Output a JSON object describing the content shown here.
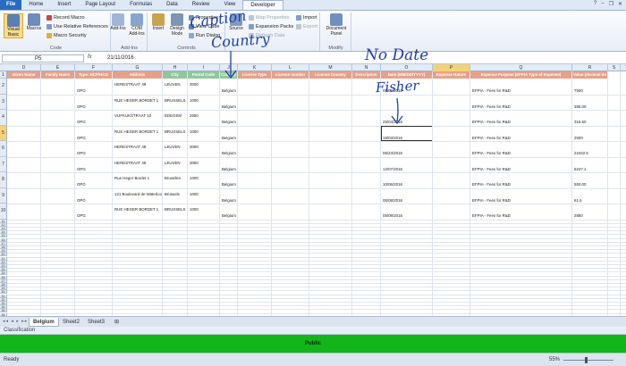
{
  "tabs": [
    "File",
    "Home",
    "Insert",
    "Page Layout",
    "Formulas",
    "Data",
    "Review",
    "View",
    "Developer"
  ],
  "active_tab": "Developer",
  "ribbon": {
    "code": {
      "name": "Code",
      "visual_basic": "Visual Basic",
      "macros": "Macros",
      "record_macro": "Record Macro",
      "relative_refs": "Use Relative References",
      "macro_security": "Macro Security"
    },
    "addins": {
      "name": "Add-Ins",
      "addins": "Add-Ins",
      "com_addins": "COM Add-Ins"
    },
    "controls": {
      "name": "Controls",
      "insert": "Insert",
      "design_mode": "Design Mode",
      "properties": "Properties",
      "view_code": "View Code",
      "run_dialog": "Run Dialog"
    },
    "xml": {
      "source": "Source",
      "map_properties": "Map Properties",
      "expansion_packs": "Expansion Packs",
      "refresh_data": "Refresh Data",
      "import": "Import",
      "export": "Export"
    },
    "modify": {
      "name": "Modify",
      "document_panel": "Document Panel"
    }
  },
  "formula_bar": {
    "name_box": "P5",
    "fx": "fx",
    "value": "21/11/2016"
  },
  "columns": [
    "D",
    "E",
    "F",
    "G",
    "H",
    "I",
    "J",
    "K",
    "L",
    "M",
    "N",
    "O",
    "P",
    "Q",
    "R",
    "S",
    "T"
  ],
  "selected_column": "P",
  "headers": [
    "Given Name",
    "Family Name",
    "Type: HCP/HCO",
    "Address",
    "City",
    "Postal Code",
    "Country",
    "License Type",
    "License number",
    "License Country",
    "Description",
    "Date (MM/DD/YYYY)",
    "Expense Nature",
    "Expense Purpose (EFPIA Type of Expense)",
    "Value (decimal do"
  ],
  "rows": [
    {
      "n": "2",
      "type": "OPG",
      "address": "HERESTRAAT 49",
      "city": "LEUVEN",
      "postal": "3000",
      "country": "Belgium",
      "date": "05/09/2016",
      "nature": "",
      "purpose": "EFPIA - Fees for R&D",
      "value": "7500"
    },
    {
      "n": "3",
      "type": "OPG",
      "address": "RUE HEGER BORDET 1",
      "city": "BRUSSELS",
      "postal": "1000",
      "country": "Belgium",
      "date": "",
      "nature": "",
      "purpose": "EFPIA - Fees for R&D",
      "value": "385.00"
    },
    {
      "n": "4",
      "type": "OPG",
      "address": "VIJFKUKSTRAAT 10",
      "city": "EDEGEM",
      "postal": "2650",
      "country": "Belgium",
      "date": "25/04/2016",
      "nature": "",
      "purpose": "EFPIA - Fees for R&D",
      "value": "316.50"
    },
    {
      "n": "5",
      "type": "OPG",
      "address": "RUE HEGER BORDET 1",
      "city": "BRUSSELS",
      "postal": "1000",
      "country": "Belgium",
      "date": "18/03/2016",
      "nature": "",
      "purpose": "EFPIA - Fees for R&D",
      "value": "2500"
    },
    {
      "n": "6",
      "type": "OPG",
      "address": "HERESTRAAT 49",
      "city": "LEUVEN",
      "postal": "3000",
      "country": "Belgium",
      "date": "06/23/2016",
      "nature": "",
      "purpose": "EFPIA - Fees for R&D",
      "value": "22422.5"
    },
    {
      "n": "7",
      "type": "OPG",
      "address": "HERESTRAAT 49",
      "city": "LEUVEN",
      "postal": "3000",
      "country": "Belgium",
      "date": "12/07/2016",
      "nature": "",
      "purpose": "EFPIA - Fees for R&D",
      "value": "6247.1"
    },
    {
      "n": "8",
      "type": "OPG",
      "address": "Rue Heger Bordet 1",
      "city": "Bruxelles",
      "postal": "1000",
      "country": "Belgium",
      "date": "10/06/2016",
      "nature": "",
      "purpose": "EFPIA - Fees for R&D",
      "value": "550.00"
    },
    {
      "n": "9",
      "type": "OPG",
      "address": "121 Boulevard de Waterloo",
      "city": "Brussels",
      "postal": "1000",
      "country": "Belgium",
      "date": "05/08/2016",
      "nature": "",
      "purpose": "EFPIA - Fees for R&D",
      "value": "61.6"
    },
    {
      "n": "10",
      "type": "OPG",
      "address": "RUE HEGER BORDET 1",
      "city": "BRUSSELS",
      "postal": "1000",
      "country": "Belgium",
      "date": "05/09/2016",
      "nature": "",
      "purpose": "EFPIA - Fees for R&D",
      "value": "2850"
    }
  ],
  "empty_rows": [
    "11",
    "12",
    "13",
    "14",
    "15",
    "16",
    "17",
    "18",
    "19",
    "20",
    "21",
    "22",
    "23",
    "24",
    "25",
    "26",
    "27",
    "28",
    "29",
    "30",
    "31",
    "32",
    "33",
    "34",
    "35",
    "36",
    "37"
  ],
  "annotations": {
    "caption_1": "Caption",
    "caption_2": "Country",
    "nodate_1": "No Date",
    "nodate_2": "Fisher"
  },
  "sheets": [
    "Belgium",
    "Sheet2",
    "Sheet3"
  ],
  "active_sheet": "Belgium",
  "classification_label": "Classification",
  "public_label": "Public",
  "status": {
    "ready": "Ready",
    "zoom": "55%"
  },
  "colors": {
    "header_red": "#e6a08a",
    "header_green": "#8fc79b",
    "public_green": "#12b51a",
    "annotation_blue": "#1f3fa6"
  }
}
